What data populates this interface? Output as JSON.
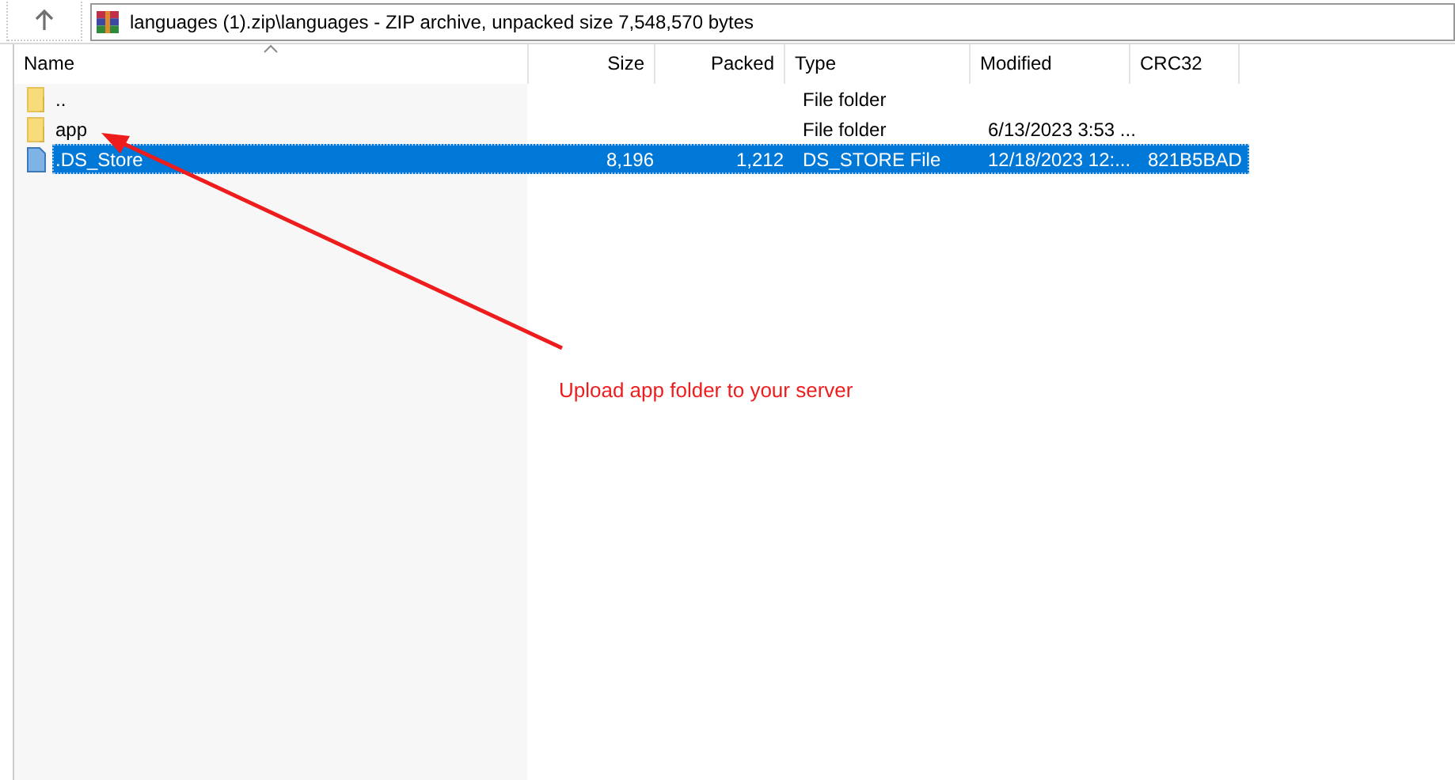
{
  "address": "languages (1).zip\\languages - ZIP archive, unpacked size 7,548,570 bytes",
  "table": {
    "columns": [
      {
        "label": "Name",
        "sorted": true
      },
      {
        "label": "Size",
        "sorted": false
      },
      {
        "label": "Packed",
        "sorted": false
      },
      {
        "label": "Type",
        "sorted": false
      },
      {
        "label": "Modified",
        "sorted": false
      },
      {
        "label": "CRC32",
        "sorted": false
      }
    ],
    "rows": [
      {
        "kind": "folder",
        "selected": false,
        "cells": [
          "..",
          "",
          "",
          "File folder",
          "",
          ""
        ]
      },
      {
        "kind": "folder",
        "selected": false,
        "cells": [
          "app",
          "",
          "",
          "File folder",
          "6/13/2023 3:53 ...",
          ""
        ]
      },
      {
        "kind": "file",
        "selected": true,
        "cells": [
          ".DS_Store",
          "8,196",
          "1,212",
          "DS_STORE File",
          "12/18/2023 12:...",
          "821B5BAD"
        ]
      }
    ]
  },
  "annotation": {
    "text": "Upload app folder to your server"
  }
}
